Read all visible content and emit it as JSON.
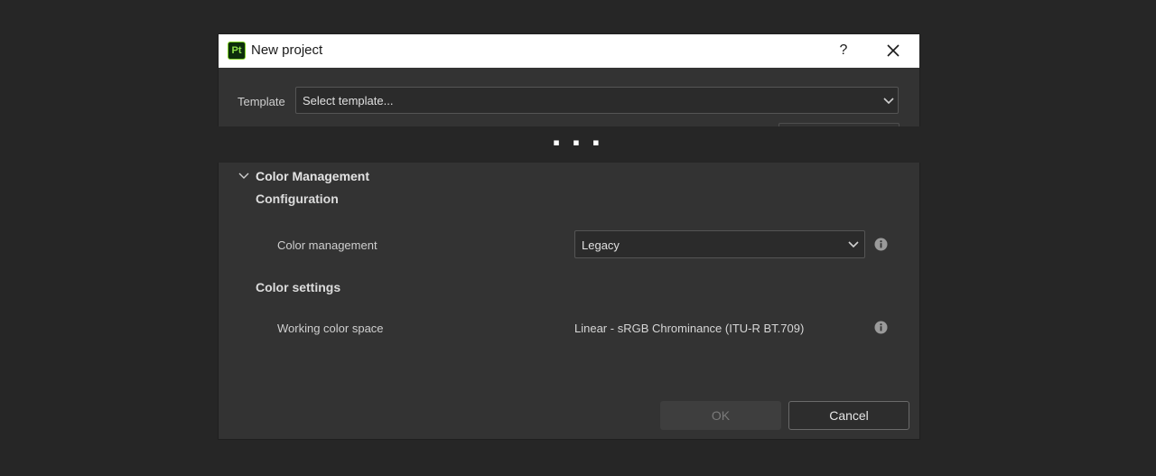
{
  "window": {
    "app_icon_text": "Pt",
    "title": "New project",
    "help_label": "?"
  },
  "template": {
    "label": "Template",
    "value": "Select template..."
  },
  "cut_indicator": "▪ ▪ ▪",
  "color_management": {
    "section_title": "Color Management",
    "configuration_heading": "Configuration",
    "color_management_label": "Color management",
    "color_management_value": "Legacy",
    "color_settings_heading": "Color settings",
    "working_color_space_label": "Working color space",
    "working_color_space_value": "Linear - sRGB Chrominance (ITU-R BT.709)"
  },
  "buttons": {
    "ok_label": "OK",
    "cancel_label": "Cancel"
  },
  "colors": {
    "app_icon_accent": "#7ed321",
    "dialog_background": "#333333",
    "titlebar_background": "#ffffff"
  }
}
